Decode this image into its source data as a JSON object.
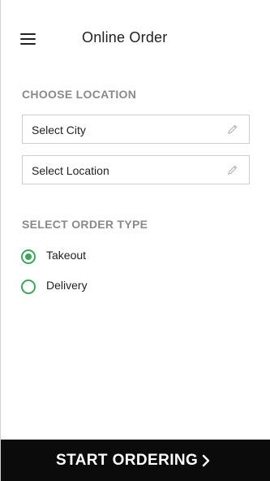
{
  "header": {
    "title": "Online Order",
    "menu_icon": "hamburger-menu-icon"
  },
  "location": {
    "section_label": "CHOOSE LOCATION",
    "city_field": {
      "value": "Select City",
      "icon": "pencil-icon"
    },
    "location_field": {
      "value": "Select Location",
      "icon": "pencil-icon"
    }
  },
  "order_type": {
    "section_label": "SELECT ORDER TYPE",
    "options": [
      {
        "label": "Takeout",
        "selected": true
      },
      {
        "label": "Delivery",
        "selected": false
      }
    ]
  },
  "cta": {
    "label": "START ORDERING",
    "icon": "chevron-right-icon"
  },
  "colors": {
    "accent": "#3aa85a",
    "cta_background": "#0b0b0b",
    "section_label": "#8a8a8a"
  }
}
